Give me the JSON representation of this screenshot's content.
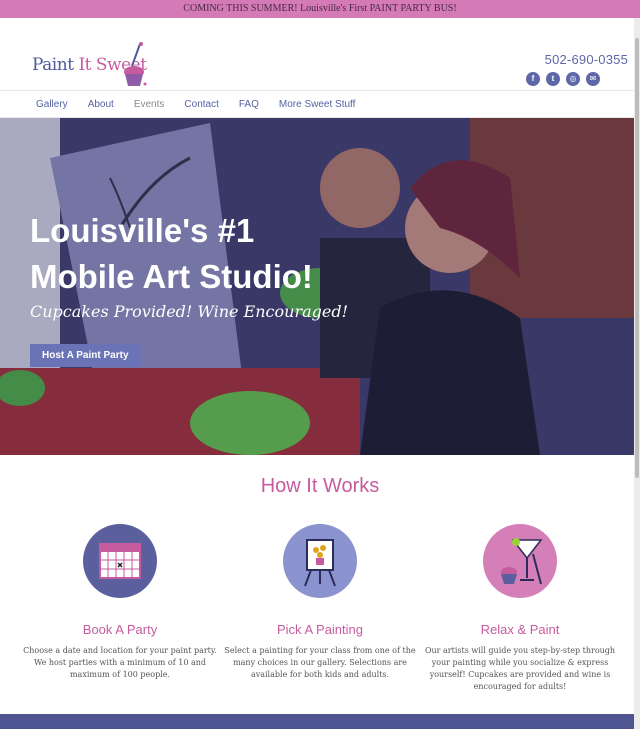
{
  "topbar": {
    "announcement": "COMING THIS SUMMER! Louisville's First PAINT PARTY BUS!"
  },
  "brand": {
    "logo_paint": "Paint",
    "logo_it": "It",
    "logo_sweet": "Sweet"
  },
  "contact": {
    "phone": "502-690-0355"
  },
  "socials": [
    {
      "icon": "facebook-icon",
      "glyph": "f"
    },
    {
      "icon": "twitter-icon",
      "glyph": "t"
    },
    {
      "icon": "instagram-icon",
      "glyph": "◎"
    },
    {
      "icon": "email-icon",
      "glyph": "✉"
    }
  ],
  "nav": {
    "items": [
      "Gallery",
      "About",
      "Events",
      "Contact",
      "FAQ",
      "More Sweet Stuff"
    ],
    "active": "Events"
  },
  "hero": {
    "title_line1": "Louisville's #1",
    "title_line2": "Mobile Art Studio!",
    "subtitle": "Cupcakes Provided! Wine Encouraged!",
    "cta": "Host A Paint Party"
  },
  "how": {
    "title": "How It Works",
    "steps": [
      {
        "title": "Book A Party",
        "text": "Choose a date and location for your paint party. We host parties with a minimum of 10 and maximum of 100 people."
      },
      {
        "title": "Pick A Painting",
        "text": "Select a painting for your class from one of the many choices in our gallery. Selections are available for both kids and adults."
      },
      {
        "title": "Relax & Paint",
        "text": "Our artists will guide you step-by-step through your painting while you socialize & express yourself! Cupcakes are provided and wine is encouraged for adults!"
      }
    ]
  },
  "colors": {
    "accent_pink": "#c65b9f",
    "accent_blue": "#5e67a8",
    "topbar": "#d47ab6",
    "footer": "#4e5591"
  }
}
